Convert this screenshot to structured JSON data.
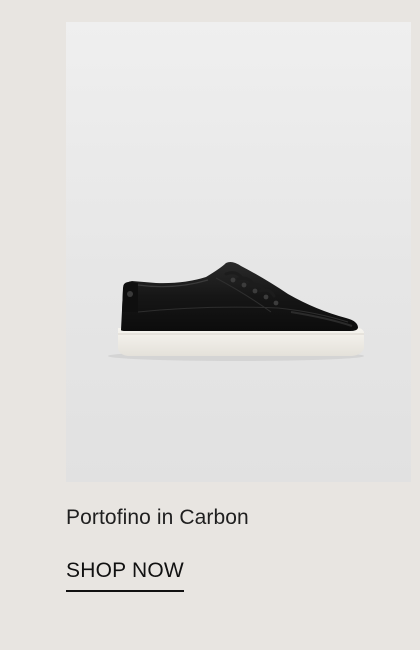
{
  "product": {
    "name": "Portofino in Carbon",
    "cta_label": "SHOP NOW",
    "image_subject": "black leather sneaker with white sole"
  },
  "colors": {
    "page_background": "#e8e5e1",
    "image_background": "#e6e6e6",
    "text": "#1f1f1f",
    "shoe_upper": "#141414",
    "shoe_sole": "#f3f1ec"
  }
}
